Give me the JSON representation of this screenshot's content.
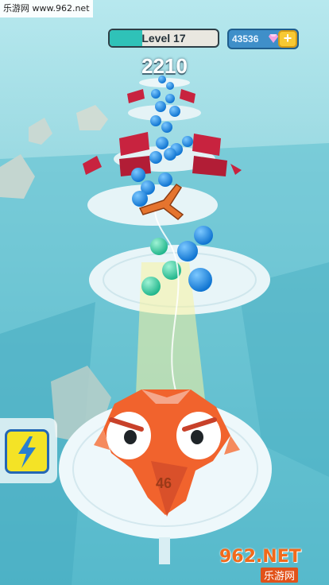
{
  "watermark_top": "乐游网 www.962.net",
  "hud": {
    "level_label": "Level 17",
    "level_progress": 0.3,
    "currency_value": "43536",
    "plus_label": "+",
    "score": "2210"
  },
  "player": {
    "number": "46"
  },
  "watermark_bottom": {
    "logo": "962.NET",
    "sub": "乐游网"
  },
  "colors": {
    "sky": "#6fc9d6",
    "platform": "#e8f4f7",
    "ball": "#1e8fe0",
    "wall": "#c8233f",
    "player": "#f1632d",
    "level_fill": "#2fc2b8",
    "power": "#f4e326"
  },
  "icons": {
    "power": "lightning-icon",
    "gem": "gem-icon"
  }
}
